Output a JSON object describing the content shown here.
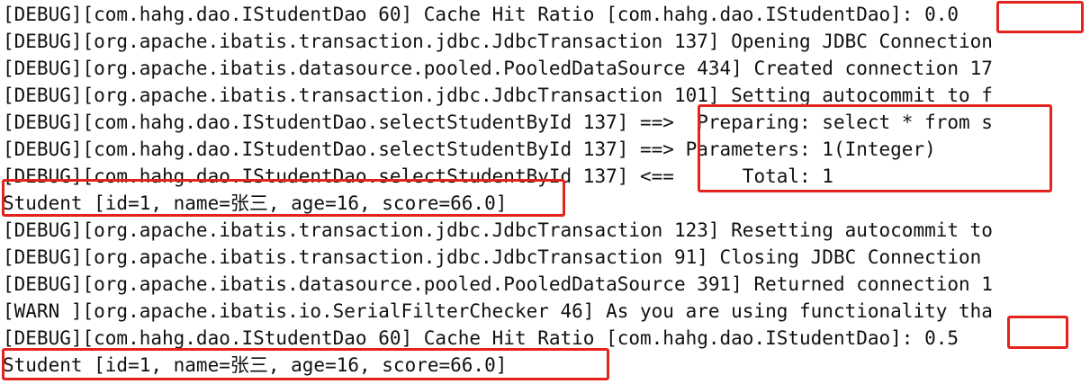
{
  "console": {
    "lines": [
      "[DEBUG][com.hahg.dao.IStudentDao 60] Cache Hit Ratio [com.hahg.dao.IStudentDao]: 0.0",
      "[DEBUG][org.apache.ibatis.transaction.jdbc.JdbcTransaction 137] Opening JDBC Connection",
      "[DEBUG][org.apache.ibatis.datasource.pooled.PooledDataSource 434] Created connection 17",
      "[DEBUG][org.apache.ibatis.transaction.jdbc.JdbcTransaction 101] Setting autocommit to f",
      "[DEBUG][com.hahg.dao.IStudentDao.selectStudentById 137] ==>  Preparing: select * from s",
      "[DEBUG][com.hahg.dao.IStudentDao.selectStudentById 137] ==> Parameters: 1(Integer)",
      "[DEBUG][com.hahg.dao.IStudentDao.selectStudentById 137] <==      Total: 1",
      "Student [id=1, name=张三, age=16, score=66.0]",
      "[DEBUG][org.apache.ibatis.transaction.jdbc.JdbcTransaction 123] Resetting autocommit to",
      "[DEBUG][org.apache.ibatis.transaction.jdbc.JdbcTransaction 91] Closing JDBC Connection",
      "[DEBUG][org.apache.ibatis.datasource.pooled.PooledDataSource 391] Returned connection 1",
      "[WARN ][org.apache.ibatis.io.SerialFilterChecker 46] As you are using functionality tha",
      "[DEBUG][com.hahg.dao.IStudentDao 60] Cache Hit Ratio [com.hahg.dao.IStudentDao]: 0.5",
      "Student [id=1, name=张三, age=16, score=66.0]"
    ]
  },
  "highlight_color": "#e4241c"
}
